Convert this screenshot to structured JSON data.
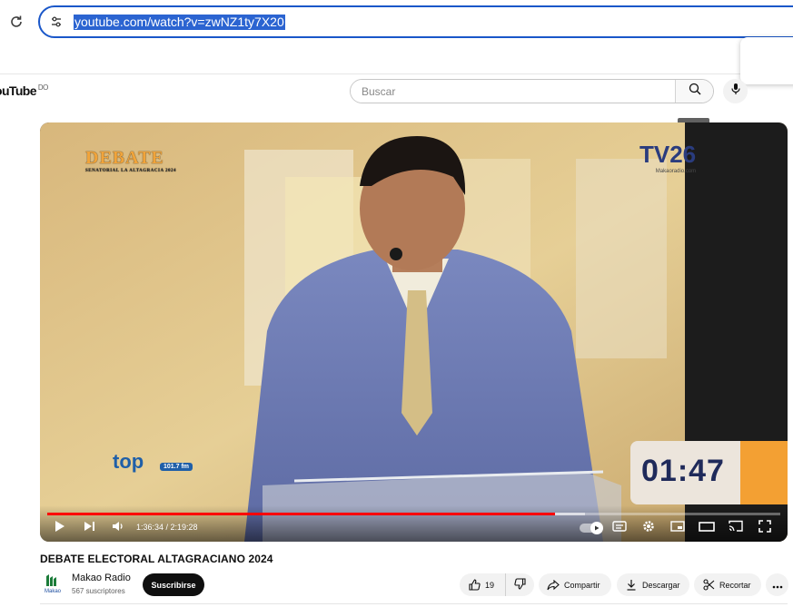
{
  "browser": {
    "url": "youtube.com/watch?v=zwNZ1ty7X20"
  },
  "youtube": {
    "logo_text": "ouTube",
    "logo_region": "DO",
    "search_placeholder": "Buscar",
    "search_tooltip": "Buscar"
  },
  "player": {
    "time_display": "1:36:34 / 2:19:28",
    "progress_fraction": 0.693,
    "overlay": {
      "debate_logo": "DEBATE",
      "debate_sub": "SENATORIAL LA ALTAGRACIA 2024",
      "tv_logo": "TV26",
      "tv_sub": "Makaoradio.com",
      "top_logo": "top",
      "top_freq": "101.7 fm",
      "timer": "01:47"
    }
  },
  "video": {
    "title": "DEBATE ELECTORAL ALTAGRACIANO 2024",
    "channel_name": "Makao Radio",
    "subscribers": "567 suscriptores",
    "avatar_text": "Makao",
    "subscribe_label": "Suscribirse",
    "likes": "19",
    "share_label": "Compartir",
    "download_label": "Descargar",
    "clip_label": "Recortar"
  },
  "colors": {
    "accent_blue": "#1a57c9",
    "youtube_red": "#ff0000"
  },
  "icons": [
    "reload-icon",
    "site-settings-icon",
    "search-icon",
    "mic-icon",
    "play-icon",
    "next-icon",
    "volume-icon",
    "autoplay-icon",
    "subtitles-icon",
    "settings-icon",
    "miniplayer-icon",
    "theater-icon",
    "cast-icon",
    "fullscreen-icon",
    "like-icon",
    "dislike-icon",
    "share-icon",
    "download-icon",
    "scissors-icon",
    "more-icon"
  ]
}
